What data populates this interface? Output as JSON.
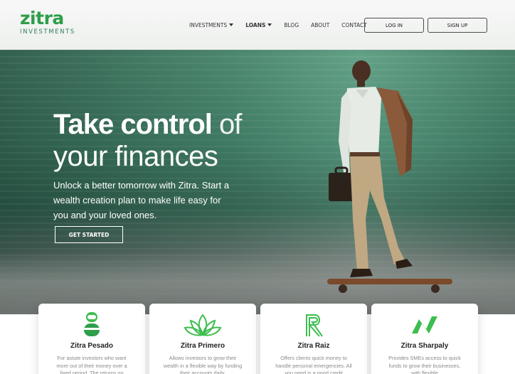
{
  "brand": {
    "name": "zitra",
    "sub": "INVESTMENTS",
    "color": "#2e9e4a"
  },
  "nav": {
    "items": [
      {
        "label": "INVESTMENTS",
        "dropdown": true,
        "bold": false
      },
      {
        "label": "LOANS",
        "dropdown": true,
        "bold": true
      },
      {
        "label": "BLOG",
        "dropdown": false,
        "bold": false
      },
      {
        "label": "ABOUT",
        "dropdown": false,
        "bold": false
      },
      {
        "label": "CONTACT",
        "dropdown": false,
        "bold": false
      }
    ],
    "login_label": "LOG IN",
    "signup_label": "SIGN UP"
  },
  "hero": {
    "title_strong": "Take control",
    "title_light": " of",
    "title_line2": "your finances",
    "subtitle": "Unlock a better tomorrow with Zitra. Start a wealth creation plan to make life easy for you and your loved ones.",
    "cta_label": "GET STARTED"
  },
  "products": [
    {
      "icon": "jar-icon",
      "title": "Zitra Pesado",
      "desc": "For astute investors who want more out of their money over a fixed period. The returns on"
    },
    {
      "icon": "lotus-icon",
      "title": "Zitra Primero",
      "desc": "Allows investors to grow their wealth in a flexible way by funding their accounts daily,"
    },
    {
      "icon": "r-logo-icon",
      "title": "Zitra Raiz",
      "desc": "Offers clients quick money to handle personal emergencies. All you need is a good credit"
    },
    {
      "icon": "n-logo-icon",
      "title": "Zitra Sharpaly",
      "desc": "Provides SMEs access to quick funds to grow their businesses, with flexible"
    }
  ],
  "colors": {
    "accent": "#2e9e4a",
    "icon_green": "#3dbd4f"
  }
}
